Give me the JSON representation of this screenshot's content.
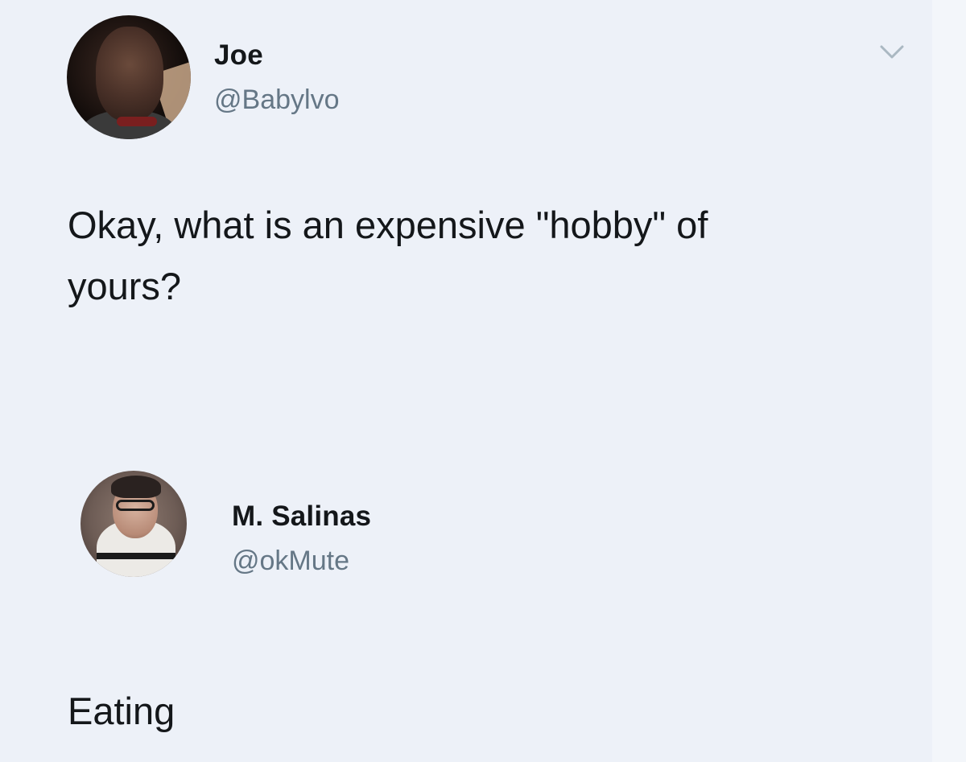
{
  "tweets": [
    {
      "display_name": "Joe",
      "handle": "@Babylvo",
      "text": "Okay, what is an expensive \"hobby\" of\nyours?",
      "avatar_icon": "profile-photo-joe"
    },
    {
      "display_name": "M. Salinas",
      "handle": "@okMute",
      "text": "Eating",
      "avatar_icon": "profile-photo-m-salinas"
    }
  ],
  "icons": {
    "more_options": "chevron-down-icon"
  },
  "colors": {
    "background": "#eef2f8",
    "text": "#14171a",
    "handle": "#657786",
    "chevron": "#aab8c2"
  }
}
